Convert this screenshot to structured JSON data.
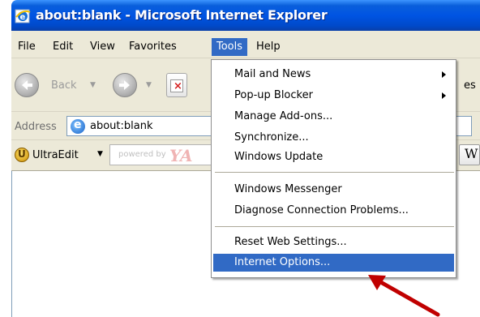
{
  "window": {
    "title": "about:blank - Microsoft Internet Explorer",
    "title_bar_color": "#0054e3"
  },
  "menubar": {
    "items": [
      {
        "label": "File",
        "icon": ""
      },
      {
        "label": "Edit"
      },
      {
        "label": "View"
      },
      {
        "label": "Favorites"
      },
      {
        "label": "Tools",
        "active": true
      },
      {
        "label": "Help"
      }
    ]
  },
  "toolbar": {
    "back_label": "Back",
    "trailing_text": "es",
    "back_icon": "back-arrow-icon",
    "forward_icon": "forward-arrow-icon",
    "stop_icon": "stop-icon"
  },
  "address": {
    "label": "Address",
    "value": "about:blank",
    "icon": "ie-page-icon"
  },
  "links": {
    "ultraedit_label": "UltraEdit",
    "yahoo_hint": "powered by",
    "yahoo_logo": "YA",
    "w_button": "W"
  },
  "tools_menu": {
    "groups": [
      [
        {
          "label": "Mail and News",
          "submenu": true
        },
        {
          "label": "Pop-up Blocker",
          "submenu": true
        },
        {
          "label": "Manage Add-ons..."
        },
        {
          "label": "Synchronize..."
        },
        {
          "label": "Windows Update"
        }
      ],
      [
        {
          "label": "Windows Messenger"
        },
        {
          "label": "Diagnose Connection Problems..."
        }
      ],
      [
        {
          "label": "Reset Web Settings..."
        },
        {
          "label": "Internet Options...",
          "highlighted": true
        }
      ]
    ],
    "highlight_color": "#316ac5"
  },
  "annotation": {
    "arrow_color": "#c00000"
  }
}
